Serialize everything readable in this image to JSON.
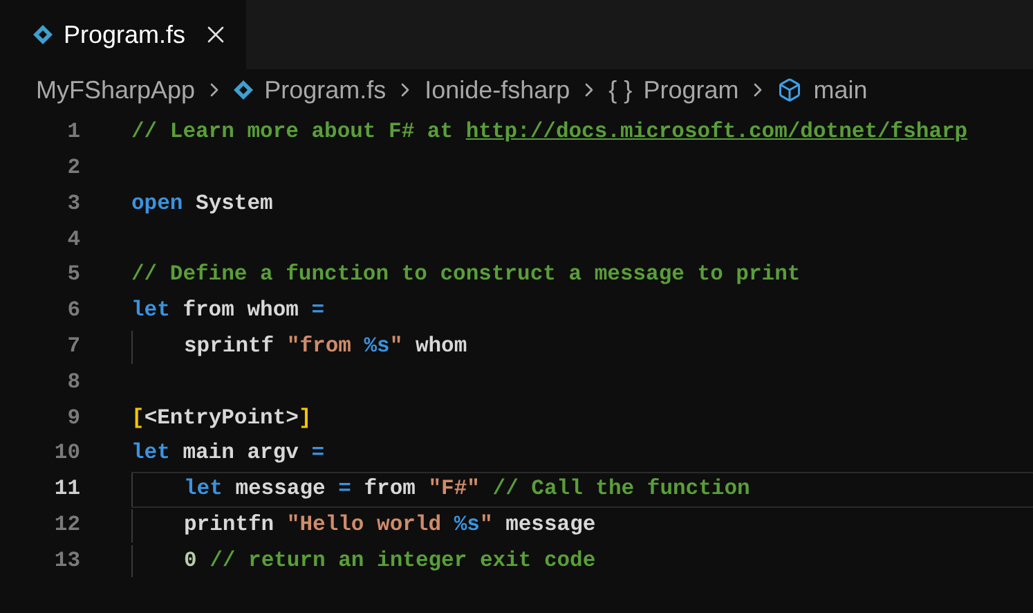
{
  "tabs": [
    {
      "label": "Program.fs",
      "selected": true
    }
  ],
  "breadcrumbs": [
    {
      "kind": "folder",
      "label": "MyFSharpApp"
    },
    {
      "kind": "file",
      "label": "Program.fs"
    },
    {
      "kind": "folder",
      "label": "Ionide-fsharp"
    },
    {
      "kind": "namespace",
      "glyph": "{ }",
      "label": "Program"
    },
    {
      "kind": "function",
      "label": "main"
    }
  ],
  "lines": [
    {
      "number": "1",
      "current": false,
      "indented": false,
      "tokens": [
        {
          "kind": "comment",
          "text": "// Learn more about F# at "
        },
        {
          "kind": "link",
          "text": "http://docs.microsoft.com/dotnet/fsharp"
        }
      ]
    },
    {
      "number": "2",
      "current": false,
      "indented": false
    },
    {
      "number": "3",
      "current": false,
      "indented": false,
      "tokens": [
        {
          "kind": "keyword",
          "text": "open"
        },
        {
          "kind": "plain",
          "text": " System"
        }
      ]
    },
    {
      "number": "4",
      "current": false,
      "indented": false
    },
    {
      "number": "5",
      "current": false,
      "indented": false,
      "tokens": [
        {
          "kind": "comment",
          "text": "// Define a function to construct a message to print"
        }
      ]
    },
    {
      "number": "6",
      "current": false,
      "indented": false,
      "tokens": [
        {
          "kind": "keyword",
          "text": "let"
        },
        {
          "kind": "plain",
          "text": " from whom "
        },
        {
          "kind": "operator",
          "text": "="
        }
      ]
    },
    {
      "number": "7",
      "current": false,
      "indented": true,
      "tokens": [
        {
          "kind": "plain",
          "text": "sprintf "
        },
        {
          "kind": "string",
          "text": "\"from "
        },
        {
          "kind": "format",
          "text": "%s"
        },
        {
          "kind": "string",
          "text": "\""
        },
        {
          "kind": "plain",
          "text": " whom"
        }
      ]
    },
    {
      "number": "8",
      "current": false,
      "indented": false
    },
    {
      "number": "9",
      "current": false,
      "indented": false,
      "tokens": [
        {
          "kind": "bracket",
          "text": "["
        },
        {
          "kind": "plain",
          "text": "<EntryPoint>"
        },
        {
          "kind": "bracket",
          "text": "]"
        }
      ]
    },
    {
      "number": "10",
      "current": false,
      "indented": false,
      "tokens": [
        {
          "kind": "keyword",
          "text": "let"
        },
        {
          "kind": "plain",
          "text": " main argv "
        },
        {
          "kind": "operator",
          "text": "="
        }
      ]
    },
    {
      "number": "11",
      "current": true,
      "indented": true,
      "tokens": [
        {
          "kind": "keyword",
          "text": "let"
        },
        {
          "kind": "plain",
          "text": " message "
        },
        {
          "kind": "operator",
          "text": "="
        },
        {
          "kind": "plain",
          "text": " from "
        },
        {
          "kind": "string",
          "text": "\"F#\""
        },
        {
          "kind": "comment",
          "text": " // Call the function"
        }
      ]
    },
    {
      "number": "12",
      "current": false,
      "indented": true,
      "tokens": [
        {
          "kind": "plain",
          "text": "printfn "
        },
        {
          "kind": "string",
          "text": "\"Hello world "
        },
        {
          "kind": "format",
          "text": "%s"
        },
        {
          "kind": "string",
          "text": "\""
        },
        {
          "kind": "plain",
          "text": " message"
        }
      ]
    },
    {
      "number": "13",
      "current": false,
      "indented": true,
      "tokens": [
        {
          "kind": "number",
          "text": "0"
        },
        {
          "kind": "comment",
          "text": " // return an integer exit code"
        }
      ]
    }
  ]
}
